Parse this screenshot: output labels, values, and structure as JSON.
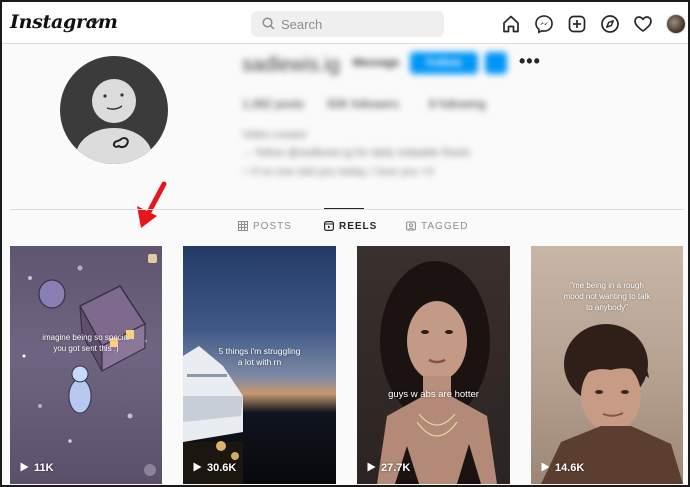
{
  "app": {
    "logo": "Instagram"
  },
  "search": {
    "placeholder": "Search"
  },
  "nav": {
    "icons": [
      "home-icon",
      "messenger-icon",
      "new-post-icon",
      "explore-icon",
      "activity-heart-icon",
      "profile-avatar"
    ]
  },
  "profile": {
    "username": "sadlewis.ig",
    "message_label": "Message",
    "follow_label": "Follow",
    "more_label": "•••",
    "posts": "1,082 posts",
    "followers": "50K followers",
    "following": "8 following",
    "bio_line1": "Video creator",
    "bio_line2": "→ follow @sadlewis.ig for daily relatable Reels",
    "bio_line3": "☝ if no one told you today, I love you <3"
  },
  "tabs": [
    {
      "label": "POSTS",
      "icon": "grid-icon",
      "active": false
    },
    {
      "label": "REELS",
      "icon": "reels-icon",
      "active": true
    },
    {
      "label": "TAGGED",
      "icon": "tagged-icon",
      "active": false
    }
  ],
  "reels": [
    {
      "caption": "imagine being so special\nyou got sent this :)",
      "views": "11K"
    },
    {
      "caption": "5 things i'm struggling\na lot with rn",
      "views": "30.6K"
    },
    {
      "caption": "guys w abs are hotter",
      "views": "27.7K"
    },
    {
      "caption": "\"me being in a rough\nmood not wanting to talk\nto anybody\"",
      "views": "14.6K"
    }
  ],
  "colors": {
    "accent": "#0095f6",
    "annotation_arrow": "#e8151b"
  }
}
